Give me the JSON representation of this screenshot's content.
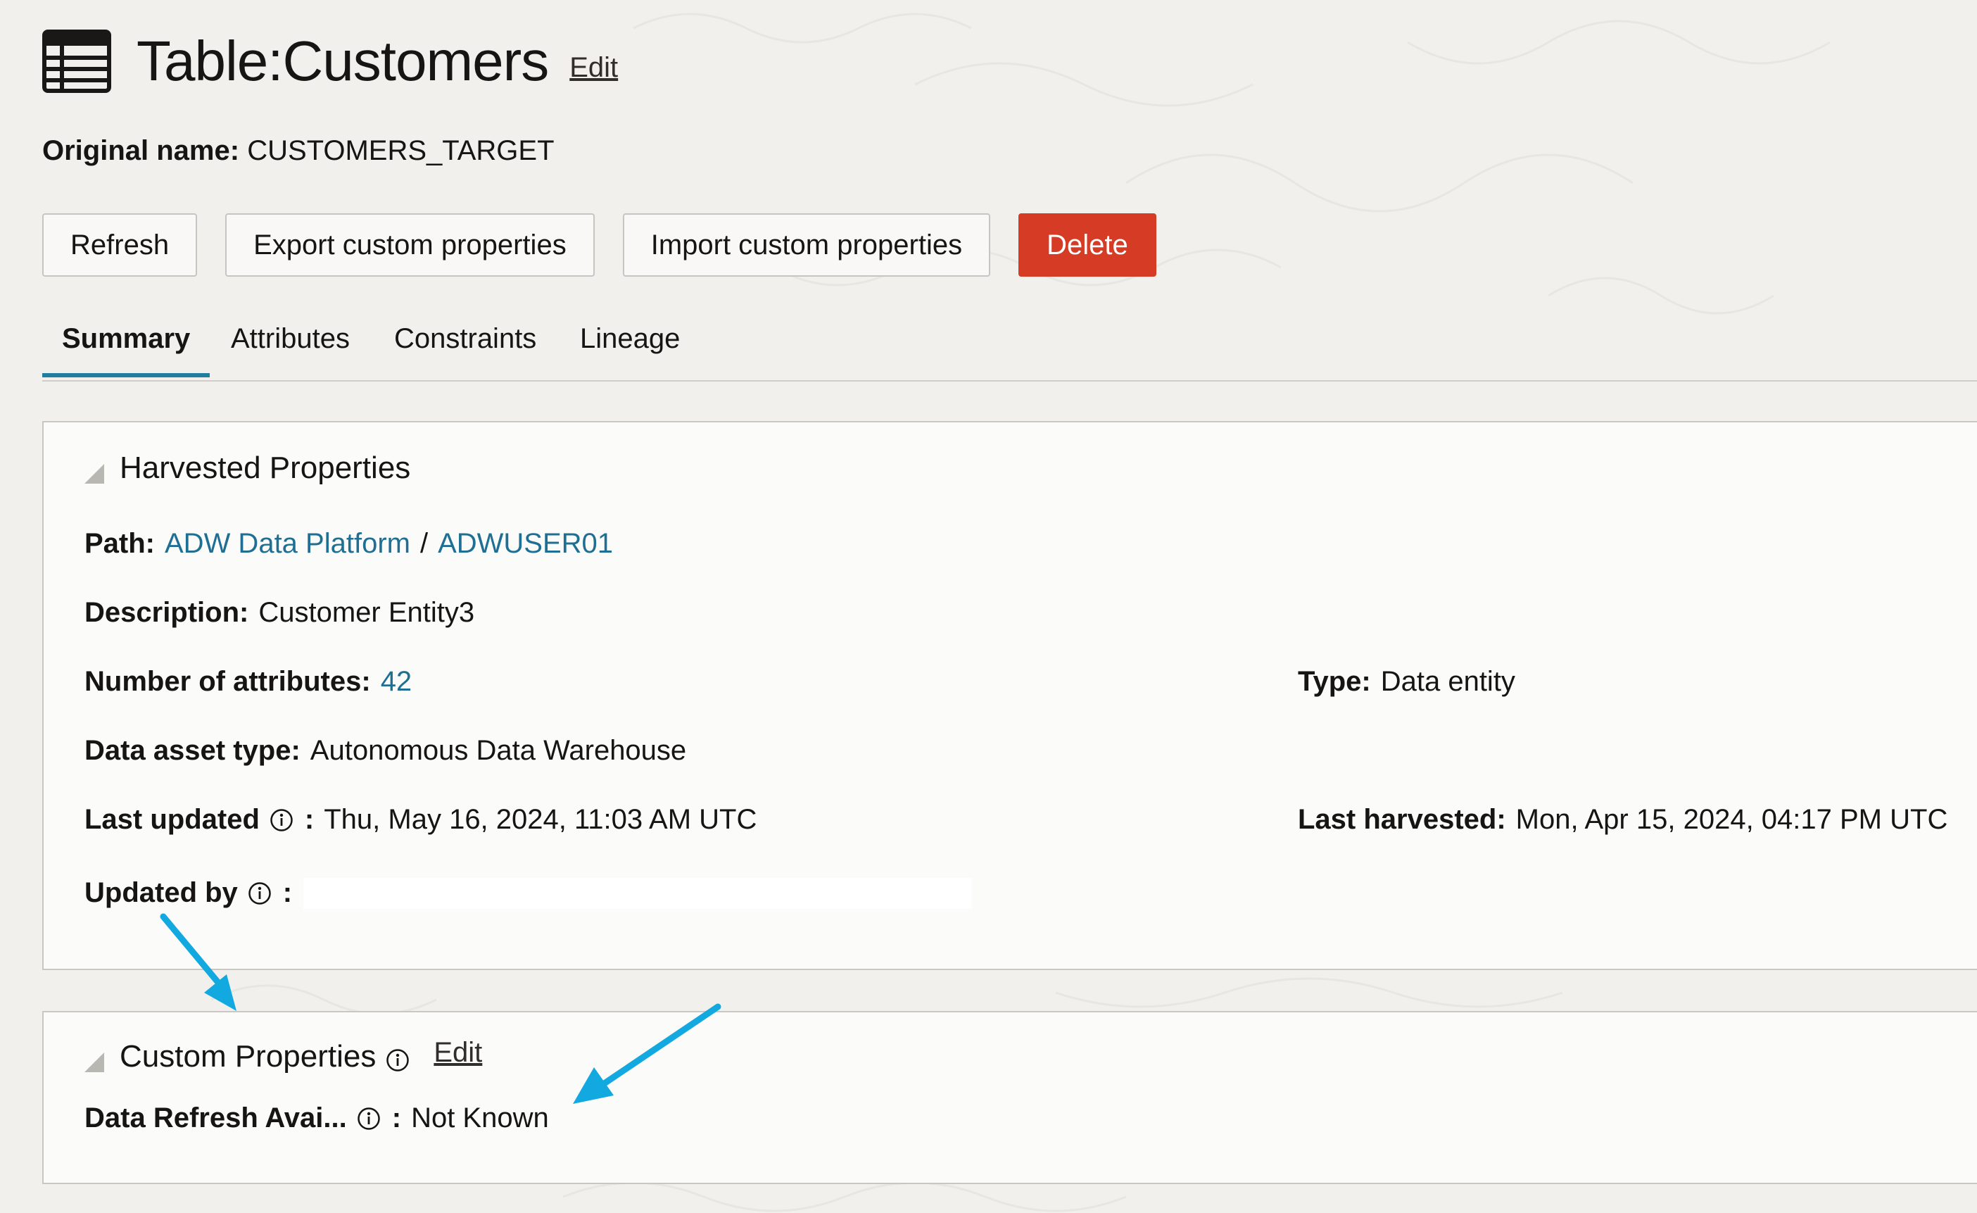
{
  "header": {
    "icon": "table-icon",
    "title": "Table:Customers",
    "edit_label": "Edit"
  },
  "original_name": {
    "label": "Original name:",
    "value": "CUSTOMERS_TARGET"
  },
  "toolbar": {
    "refresh_label": "Refresh",
    "export_label": "Export custom properties",
    "import_label": "Import custom properties",
    "delete_label": "Delete",
    "delete_color": "#d63b25"
  },
  "tabs": [
    {
      "label": "Summary",
      "active": true
    },
    {
      "label": "Attributes",
      "active": false
    },
    {
      "label": "Constraints",
      "active": false
    },
    {
      "label": "Lineage",
      "active": false
    }
  ],
  "accent_color": "#227e9e",
  "harvested": {
    "title": "Harvested Properties",
    "path_label": "Path:",
    "path_parts": [
      "ADW Data Platform",
      "ADWUSER01"
    ],
    "path_separator": "/",
    "description_label": "Description:",
    "description_value": "Customer Entity3",
    "num_attributes_label": "Number of attributes:",
    "num_attributes_value": "42",
    "type_label": "Type:",
    "type_value": "Data entity",
    "data_asset_type_label": "Data asset type:",
    "data_asset_type_value": "Autonomous Data Warehouse",
    "last_updated_label": "Last updated",
    "last_updated_value": "Thu, May 16, 2024, 11:03 AM UTC",
    "last_harvested_label": "Last harvested:",
    "last_harvested_value": "Mon, Apr 15, 2024, 04:17 PM UTC",
    "updated_by_label": "Updated by",
    "colon": ":"
  },
  "custom": {
    "title": "Custom Properties",
    "edit_label": "Edit",
    "data_refresh_label": "Data Refresh Avai...",
    "data_refresh_value": "Not Known"
  },
  "annotation_color": "#12a9e0"
}
